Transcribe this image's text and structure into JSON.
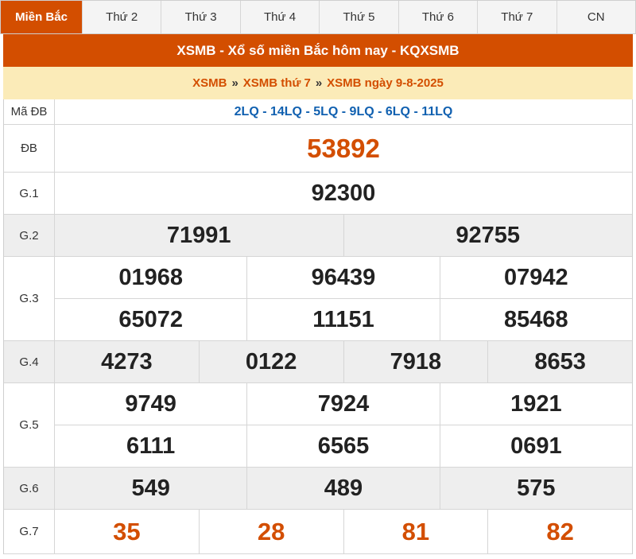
{
  "tabs": [
    {
      "label": "Miền Bắc",
      "active": true
    },
    {
      "label": "Thứ 2"
    },
    {
      "label": "Thứ 3"
    },
    {
      "label": "Thứ 4"
    },
    {
      "label": "Thứ 5"
    },
    {
      "label": "Thứ 6"
    },
    {
      "label": "Thứ 7"
    },
    {
      "label": "CN"
    }
  ],
  "title": "XSMB - Xổ số miền Bắc hôm nay - KQXSMB",
  "breadcrumb": {
    "items": [
      "XSMB",
      "XSMB thứ 7",
      "XSMB ngày 9-8-2025"
    ],
    "separator": "»"
  },
  "results": {
    "madb": {
      "label": "Mã ĐB",
      "value": "2LQ - 14LQ - 5LQ - 9LQ - 6LQ - 11LQ"
    },
    "db": {
      "label": "ĐB",
      "values": [
        "53892"
      ]
    },
    "g1": {
      "label": "G.1",
      "values": [
        "92300"
      ]
    },
    "g2": {
      "label": "G.2",
      "values": [
        "71991",
        "92755"
      ]
    },
    "g3": {
      "label": "G.3",
      "values": [
        "01968",
        "96439",
        "07942",
        "65072",
        "11151",
        "85468"
      ]
    },
    "g4": {
      "label": "G.4",
      "values": [
        "4273",
        "0122",
        "7918",
        "8653"
      ]
    },
    "g5": {
      "label": "G.5",
      "values": [
        "9749",
        "7924",
        "1921",
        "6111",
        "6565",
        "0691"
      ]
    },
    "g6": {
      "label": "G.6",
      "values": [
        "549",
        "489",
        "575"
      ]
    },
    "g7": {
      "label": "G.7",
      "values": [
        "35",
        "28",
        "81",
        "82"
      ]
    }
  },
  "colors": {
    "accent": "#d34e00",
    "breadcrumb_bg": "#fbebb8",
    "code_blue": "#1060b0",
    "row_gray": "#eeeeee"
  }
}
